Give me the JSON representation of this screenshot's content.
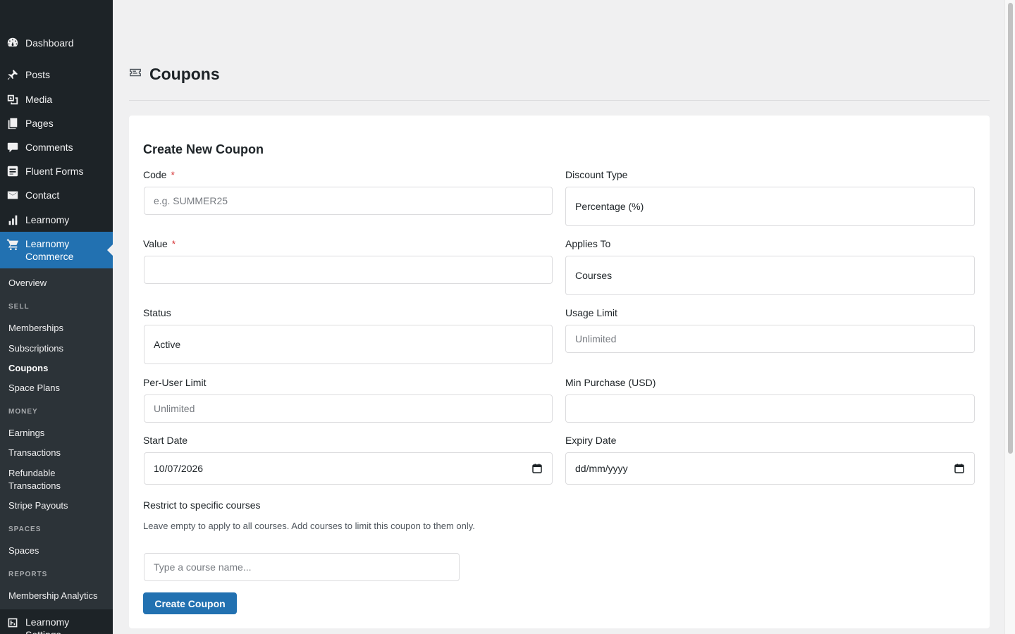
{
  "sidebar": {
    "items": [
      {
        "label": "Dashboard",
        "icon": "dashboard-icon"
      },
      {
        "label": "Posts",
        "icon": "pin-icon"
      },
      {
        "label": "Media",
        "icon": "media-icon"
      },
      {
        "label": "Pages",
        "icon": "pages-icon"
      },
      {
        "label": "Comments",
        "icon": "comment-icon"
      },
      {
        "label": "Fluent Forms",
        "icon": "forms-icon"
      },
      {
        "label": "Contact",
        "icon": "envelope-icon"
      },
      {
        "label": "Learnomy",
        "icon": "chart-bars-icon"
      }
    ],
    "active": {
      "label_line1": "Learnomy",
      "label_line2": "Commerce",
      "icon": "cart-icon"
    },
    "submenu": {
      "overview": "Overview",
      "sell_heading": "SELL",
      "memberships": "Memberships",
      "subscriptions": "Subscriptions",
      "coupons": "Coupons",
      "space_plans": "Space Plans",
      "money_heading": "MONEY",
      "earnings": "Earnings",
      "transactions": "Transactions",
      "refundable_line1": "Refundable",
      "refundable_line2": "Transactions",
      "stripe_payouts": "Stripe Payouts",
      "spaces_heading": "SPACES",
      "spaces": "Spaces",
      "reports_heading": "REPORTS",
      "membership_analytics": "Membership Analytics"
    },
    "bottom": {
      "label_line1": "Learnomy",
      "label_line2": "Settings",
      "icon": "settings-grid-icon"
    }
  },
  "page": {
    "title": "Coupons",
    "icon": "ticket-icon"
  },
  "form": {
    "title": "Create New Coupon",
    "required_mark": "*",
    "code": {
      "label": "Code",
      "placeholder": "e.g. SUMMER25"
    },
    "discount_type": {
      "label": "Discount Type",
      "value": "Percentage (%)"
    },
    "value": {
      "label": "Value",
      "value": ""
    },
    "applies_to": {
      "label": "Applies To",
      "value": "Courses"
    },
    "status": {
      "label": "Status",
      "value": "Active"
    },
    "usage_limit": {
      "label": "Usage Limit",
      "placeholder": "Unlimited"
    },
    "per_user_limit": {
      "label": "Per-User Limit",
      "placeholder": "Unlimited"
    },
    "min_purchase": {
      "label": "Min Purchase (USD)",
      "value": ""
    },
    "start_date": {
      "label": "Start Date",
      "value": "10/07/2026"
    },
    "expiry_date": {
      "label": "Expiry Date",
      "value": "dd/mm/yyyy"
    },
    "restrict": {
      "label": "Restrict to specific courses",
      "help": "Leave empty to apply to all courses. Add courses to limit this coupon to them only.",
      "placeholder": "Type a course name..."
    },
    "submit_label": "Create Coupon"
  },
  "colors": {
    "sidebar_bg": "#1d2327",
    "accent": "#2271b1",
    "required": "#d63638"
  }
}
